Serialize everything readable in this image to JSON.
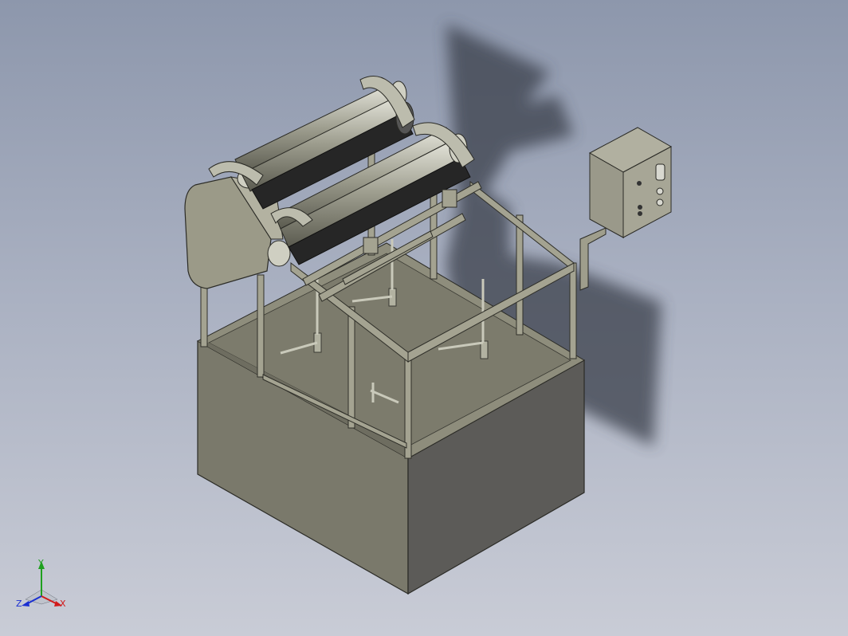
{
  "viewport": {
    "background_top": "#8d97ac",
    "background_bottom": "#c9ccd6"
  },
  "model": {
    "body_color": "#7b7a6b",
    "frame_color": "#a6a593",
    "roller_color": "#2a2a2a",
    "shadow_color": "#3a3f4a"
  },
  "axis_triad": {
    "x_label": "X",
    "y_label": "Y",
    "z_label": "Z",
    "x_color": "#d11a1a",
    "y_color": "#1fa01f",
    "z_color": "#1a2fd1"
  }
}
